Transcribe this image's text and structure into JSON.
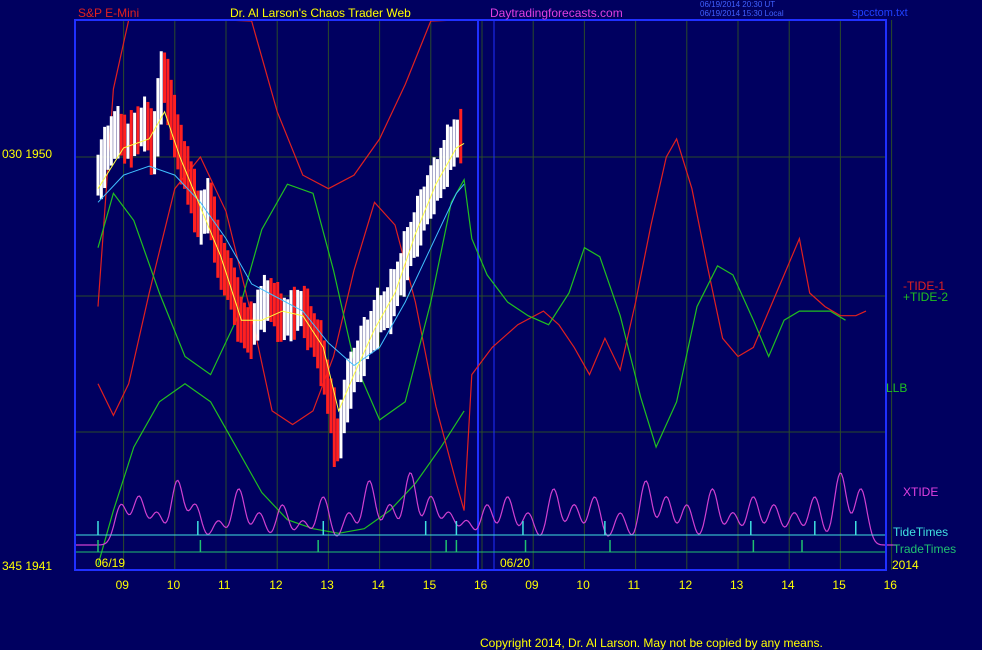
{
  "header": {
    "instrument": "S&P E-Mini",
    "site_title": "Dr. Al Larson's Chaos Trader Web",
    "site_url": "Daytradingforecasts.com",
    "timestamp_ut": "06/19/2014 20:30 UT",
    "timestamp_local": "06/19/2014 15:30 Local",
    "file_name": "spcctom.txt"
  },
  "footer": {
    "copyright": "Copyright 2014, Dr. Al Larson. May not be copied by any means."
  },
  "colors": {
    "background": "#000060",
    "plot_border": "#2030ff",
    "grid": "#2a4a2a",
    "tide1": "#e02020",
    "tide2": "#20c020",
    "llb_upper": "#e02020",
    "llb_lower": "#20c020",
    "xtide": "#d040d0",
    "tide_times": "#40e0e0",
    "trade_times": "#20c070",
    "ma_fast": "#ffff40",
    "ma_slow": "#40c0ff",
    "bar_up": "#ffffff",
    "bar_down": "#ff2020",
    "text_yellow": "#ffff00",
    "text_magenta": "#e040e0"
  },
  "chart_data": {
    "type": "line",
    "title": "S&P E-Mini",
    "y_tick_labels": [
      {
        "label": "030  1950",
        "price": 1950
      },
      {
        "label": "345  1941",
        "price": 1941
      }
    ],
    "x_tick_labels": [
      "09",
      "10",
      "11",
      "12",
      "13",
      "14",
      "15",
      "16",
      "09",
      "10",
      "11",
      "12",
      "13",
      "14",
      "15",
      "16"
    ],
    "date_labels": [
      "06/19",
      "06/20",
      "2014"
    ],
    "series_labels": [
      "-TIDE-1",
      "+TIDE-2",
      "LLB",
      "XTIDE",
      "TideTimes",
      "TradeTimes"
    ],
    "session_break_hour": 8,
    "price_path": [
      [
        0.0,
        1949.6
      ],
      [
        0.15,
        1950.2
      ],
      [
        0.35,
        1950.6
      ],
      [
        0.55,
        1950.3
      ],
      [
        0.75,
        1950.6
      ],
      [
        0.95,
        1950.8
      ],
      [
        1.05,
        1950.0
      ],
      [
        1.15,
        1951.0
      ],
      [
        1.25,
        1952.0
      ],
      [
        1.35,
        1951.3
      ],
      [
        1.55,
        1950.2
      ],
      [
        1.75,
        1949.5
      ],
      [
        1.95,
        1948.6
      ],
      [
        2.15,
        1949.0
      ],
      [
        2.35,
        1947.7
      ],
      [
        2.55,
        1947.3
      ],
      [
        2.75,
        1946.4
      ],
      [
        2.95,
        1946.1
      ],
      [
        3.15,
        1946.7
      ],
      [
        3.35,
        1946.9
      ],
      [
        3.55,
        1946.4
      ],
      [
        3.75,
        1946.5
      ],
      [
        3.95,
        1946.7
      ],
      [
        4.15,
        1946.2
      ],
      [
        4.35,
        1945.6
      ],
      [
        4.55,
        1944.3
      ],
      [
        4.65,
        1943.5
      ],
      [
        4.8,
        1944.7
      ],
      [
        5.0,
        1945.4
      ],
      [
        5.2,
        1945.9
      ],
      [
        5.45,
        1946.5
      ],
      [
        5.65,
        1946.7
      ],
      [
        5.85,
        1947.3
      ],
      [
        6.05,
        1948.0
      ],
      [
        6.25,
        1948.6
      ],
      [
        6.45,
        1949.2
      ],
      [
        6.65,
        1949.6
      ],
      [
        6.85,
        1950.2
      ],
      [
        7.05,
        1950.5
      ],
      [
        7.15,
        1950.4
      ]
    ],
    "ma_fast": [
      [
        0.0,
        1949.3
      ],
      [
        0.5,
        1950.2
      ],
      [
        1.0,
        1950.4
      ],
      [
        1.3,
        1951.0
      ],
      [
        1.6,
        1950.0
      ],
      [
        2.0,
        1948.9
      ],
      [
        2.4,
        1947.8
      ],
      [
        2.8,
        1946.4
      ],
      [
        3.2,
        1946.4
      ],
      [
        3.6,
        1946.6
      ],
      [
        4.0,
        1946.5
      ],
      [
        4.4,
        1945.8
      ],
      [
        4.7,
        1944.4
      ],
      [
        5.0,
        1945.2
      ],
      [
        5.4,
        1946.2
      ],
      [
        5.8,
        1947.0
      ],
      [
        6.2,
        1948.3
      ],
      [
        6.6,
        1949.4
      ],
      [
        7.0,
        1950.2
      ],
      [
        7.15,
        1950.3
      ]
    ],
    "ma_slow": [
      [
        0.0,
        1949.0
      ],
      [
        0.5,
        1949.6
      ],
      [
        1.0,
        1949.8
      ],
      [
        1.5,
        1949.6
      ],
      [
        2.0,
        1949.0
      ],
      [
        2.5,
        1948.2
      ],
      [
        3.0,
        1947.2
      ],
      [
        3.5,
        1946.9
      ],
      [
        4.0,
        1946.6
      ],
      [
        4.5,
        1945.9
      ],
      [
        5.0,
        1945.4
      ],
      [
        5.5,
        1945.8
      ],
      [
        6.0,
        1946.8
      ],
      [
        6.5,
        1948.0
      ],
      [
        7.0,
        1949.2
      ],
      [
        7.15,
        1949.4
      ]
    ],
    "tide1": [
      [
        0.0,
        1945.0
      ],
      [
        0.3,
        1944.3
      ],
      [
        0.6,
        1945.0
      ],
      [
        1.0,
        1947.0
      ],
      [
        1.5,
        1949.3
      ],
      [
        2.0,
        1950.0
      ],
      [
        2.5,
        1948.8
      ],
      [
        3.0,
        1946.5
      ],
      [
        3.4,
        1944.4
      ],
      [
        3.8,
        1944.1
      ],
      [
        4.2,
        1944.4
      ],
      [
        4.6,
        1945.6
      ],
      [
        5.0,
        1947.5
      ],
      [
        5.4,
        1949.0
      ],
      [
        5.8,
        1948.5
      ],
      [
        6.2,
        1946.8
      ],
      [
        6.6,
        1944.5
      ],
      [
        7.0,
        1942.8
      ],
      [
        7.15,
        1942.2
      ],
      [
        7.3,
        1945.2
      ],
      [
        7.7,
        1945.8
      ],
      [
        8.2,
        1946.3
      ],
      [
        8.7,
        1946.6
      ],
      [
        9.0,
        1946.3
      ],
      [
        9.3,
        1945.8
      ],
      [
        9.6,
        1945.2
      ],
      [
        9.9,
        1946.0
      ],
      [
        10.2,
        1945.3
      ],
      [
        10.5,
        1946.8
      ],
      [
        10.8,
        1948.5
      ],
      [
        11.1,
        1950.0
      ],
      [
        11.3,
        1950.4
      ],
      [
        11.6,
        1949.3
      ],
      [
        11.9,
        1947.6
      ],
      [
        12.2,
        1946.0
      ],
      [
        12.5,
        1945.6
      ],
      [
        12.8,
        1945.8
      ],
      [
        13.1,
        1946.6
      ],
      [
        13.4,
        1947.4
      ],
      [
        13.7,
        1948.2
      ],
      [
        13.9,
        1947.0
      ],
      [
        14.2,
        1946.7
      ],
      [
        14.5,
        1946.5
      ],
      [
        14.8,
        1946.5
      ],
      [
        15.0,
        1946.6
      ]
    ],
    "tide2": [
      [
        0.0,
        1948.0
      ],
      [
        0.3,
        1949.2
      ],
      [
        0.7,
        1948.6
      ],
      [
        1.2,
        1947.0
      ],
      [
        1.7,
        1945.6
      ],
      [
        2.2,
        1945.2
      ],
      [
        2.7,
        1946.4
      ],
      [
        3.2,
        1948.4
      ],
      [
        3.7,
        1949.4
      ],
      [
        4.2,
        1949.2
      ],
      [
        4.6,
        1947.5
      ],
      [
        5.0,
        1945.5
      ],
      [
        5.5,
        1944.2
      ],
      [
        6.0,
        1944.6
      ],
      [
        6.5,
        1946.8
      ],
      [
        6.9,
        1949.0
      ],
      [
        7.15,
        1949.5
      ],
      [
        7.3,
        1948.2
      ],
      [
        7.6,
        1947.4
      ],
      [
        8.0,
        1946.8
      ],
      [
        8.4,
        1946.5
      ],
      [
        8.8,
        1946.3
      ],
      [
        9.2,
        1947.0
      ],
      [
        9.5,
        1948.0
      ],
      [
        9.8,
        1947.8
      ],
      [
        10.2,
        1946.5
      ],
      [
        10.6,
        1944.7
      ],
      [
        10.9,
        1943.6
      ],
      [
        11.3,
        1944.6
      ],
      [
        11.7,
        1946.7
      ],
      [
        12.1,
        1947.6
      ],
      [
        12.4,
        1947.4
      ],
      [
        12.8,
        1946.4
      ],
      [
        13.1,
        1945.6
      ],
      [
        13.4,
        1946.4
      ],
      [
        13.7,
        1946.6
      ],
      [
        14.0,
        1946.6
      ],
      [
        14.3,
        1946.6
      ],
      [
        14.6,
        1946.4
      ]
    ],
    "llb_upper": [
      [
        0.0,
        1946.7
      ],
      [
        0.3,
        1951.5
      ],
      [
        0.6,
        1954.5
      ],
      [
        1.0,
        1956.5
      ],
      [
        1.5,
        1957.5
      ],
      [
        2.0,
        1957.0
      ],
      [
        2.5,
        1955.0
      ],
      [
        3.0,
        1953.0
      ],
      [
        3.5,
        1951.0
      ],
      [
        4.0,
        1949.6
      ],
      [
        4.5,
        1949.3
      ],
      [
        5.0,
        1949.6
      ],
      [
        5.5,
        1950.4
      ],
      [
        6.0,
        1951.6
      ],
      [
        6.5,
        1953.0
      ],
      [
        7.0,
        1955.0
      ]
    ],
    "llb_lower": [
      [
        0.0,
        1941.0
      ],
      [
        0.3,
        1942.2
      ],
      [
        0.7,
        1943.6
      ],
      [
        1.2,
        1944.6
      ],
      [
        1.7,
        1945.0
      ],
      [
        2.2,
        1944.6
      ],
      [
        2.7,
        1943.6
      ],
      [
        3.2,
        1942.6
      ],
      [
        3.7,
        1942.0
      ],
      [
        4.2,
        1941.8
      ],
      [
        4.7,
        1941.7
      ],
      [
        5.2,
        1941.8
      ],
      [
        5.7,
        1942.2
      ],
      [
        6.2,
        1942.8
      ],
      [
        6.7,
        1943.6
      ],
      [
        7.15,
        1944.4
      ]
    ],
    "xtide_peaks": [
      0.45,
      0.8,
      1.15,
      1.55,
      1.9,
      2.35,
      2.75,
      3.15,
      3.6,
      4.0,
      4.4,
      4.9,
      5.3,
      5.7,
      6.1,
      6.5,
      6.85,
      7.2,
      7.6,
      8.0,
      8.4,
      8.9,
      9.3,
      9.7,
      10.2,
      10.7,
      11.1,
      11.5,
      12.0,
      12.4,
      12.8,
      13.2,
      13.6,
      14.0,
      14.5,
      14.9
    ],
    "xtide_heights": [
      0.5,
      0.6,
      0.4,
      0.8,
      0.5,
      0.3,
      0.7,
      0.4,
      0.5,
      0.3,
      0.6,
      0.4,
      0.8,
      0.5,
      0.9,
      0.6,
      0.4,
      0.3,
      0.5,
      0.6,
      0.4,
      0.7,
      0.5,
      0.6,
      0.4,
      0.8,
      0.6,
      0.5,
      0.7,
      0.4,
      0.6,
      0.5,
      0.4,
      0.6,
      0.9,
      0.7
    ],
    "tide_times": [
      0.0,
      1.95,
      4.4,
      6.4,
      7.0,
      8.3,
      9.9,
      12.75,
      14.0,
      14.8
    ],
    "trade_times": [
      0.0,
      2.0,
      4.3,
      6.8,
      7.0,
      8.35,
      10.0,
      12.8,
      13.75
    ]
  }
}
